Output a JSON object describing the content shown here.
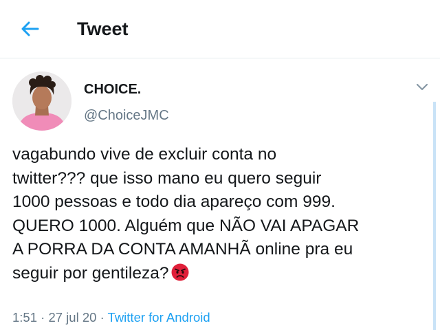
{
  "header": {
    "back_icon": "arrow-left-icon",
    "title": "Tweet"
  },
  "tweet": {
    "author": {
      "display_name": "CHOICE.",
      "handle": "@ChoiceJMC"
    },
    "text_lines": [
      "vagabundo vive de excluir conta no",
      "twitter??? que isso mano eu quero seguir",
      "1000 pessoas e todo dia apareço com 999.",
      "QUERO 1000. Alguém que NÃO VAI APAGAR",
      "A PORRA DA CONTA AMANHÃ online pra eu",
      "seguir por gentileza?"
    ],
    "emoji": "angry-face-icon",
    "time": "1:51",
    "separator": "·",
    "date": "27 jul 20",
    "source": "Twitter for Android"
  },
  "colors": {
    "accent": "#1da1f2",
    "secondary_text": "#657786",
    "text": "#14171a",
    "emoji_red": "#e0203a"
  }
}
